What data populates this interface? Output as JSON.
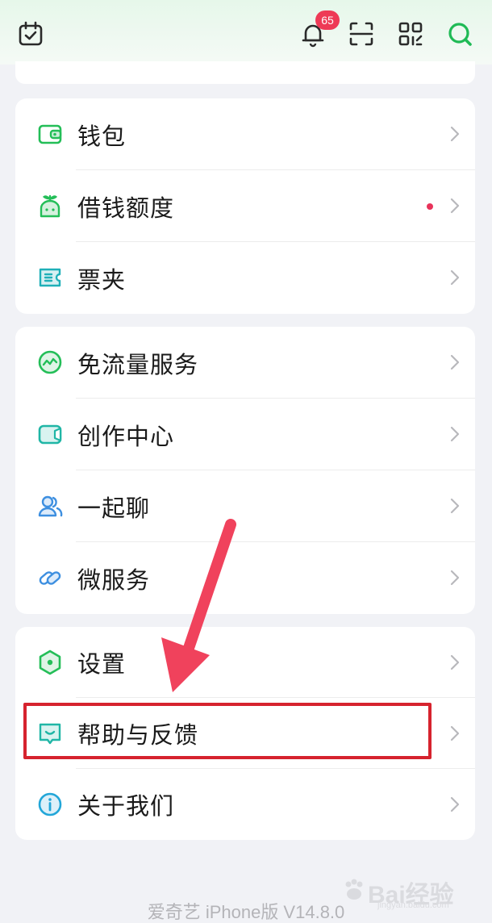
{
  "header": {
    "notification_count": "65",
    "icons": [
      "calendar-check-icon",
      "bell-icon",
      "scan-icon",
      "qr-code-icon",
      "search-icon"
    ]
  },
  "groups": [
    {
      "items": [
        {
          "label": "钱包",
          "icon": "wallet-icon"
        },
        {
          "label": "借钱额度",
          "icon": "sprout-icon",
          "has_red_dot": true
        },
        {
          "label": "票夹",
          "icon": "ticket-icon"
        }
      ]
    },
    {
      "items": [
        {
          "label": "免流量服务",
          "icon": "traffic-chart-icon"
        },
        {
          "label": "创作中心",
          "icon": "video-camera-icon"
        },
        {
          "label": "一起聊",
          "icon": "people-icon"
        },
        {
          "label": "微服务",
          "icon": "link-icon"
        }
      ]
    },
    {
      "items": [
        {
          "label": "设置",
          "icon": "hexagon-settings-icon"
        },
        {
          "label": "帮助与反馈",
          "icon": "feedback-chat-icon",
          "highlighted": true
        },
        {
          "label": "关于我们",
          "icon": "info-icon"
        }
      ]
    }
  ],
  "footer": {
    "version_text": "爱奇艺 iPhone版 V14.8.0"
  },
  "watermark": {
    "text": "Bai经验",
    "sub": "jingyan.baidu.com"
  },
  "colors": {
    "accent_green": "#27c15a",
    "highlight_red": "#d6232e",
    "arrow_pink": "#f0425c",
    "badge_red": "#ee3a56"
  }
}
